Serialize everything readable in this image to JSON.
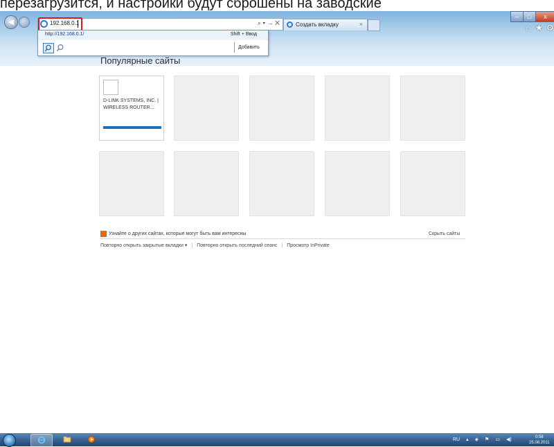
{
  "caption": "перезагрузится, и настройки будут сброшены на заводские",
  "browser": {
    "address_value": "192.168.0.1",
    "address_controls": "⌕ ▾ → ✕",
    "tab_title": "Создать вкладку",
    "tab_close": "×",
    "window_controls": {
      "minimize": "–",
      "maximize": "□",
      "close": "x"
    },
    "command_icons": {
      "home": "⌂",
      "favorites": "★",
      "tools": "⚙"
    }
  },
  "dropdown": {
    "suggestion_url": "http://192.168.0.1/",
    "shortcut_hint": "Shift + Ввод",
    "add_label": "Добавить"
  },
  "content": {
    "section_title": "Популярные сайты",
    "tiles": [
      {
        "name": "D-LINK SYSTEMS, INC. | WIRELESS ROUTER...",
        "usage_level": 0.95
      }
    ],
    "tip_text": "Узнайте о других сайтах, которые могут быть вам интересны",
    "hide_sites": "Скрыть сайты",
    "links": {
      "reopen_tabs": "Повторно открыть закрытые вкладки ▾",
      "reopen_session": "Повторно открыть последний сеанс",
      "inprivate": "Просмотр InPrivate"
    }
  },
  "taskbar": {
    "language": "RU",
    "clock_time": "0:58",
    "clock_date": "25.08.2011"
  },
  "colors": {
    "address_highlight": "#e01616",
    "usage_bar": "#1f6fb7",
    "tip_icon": "#e36c09"
  }
}
